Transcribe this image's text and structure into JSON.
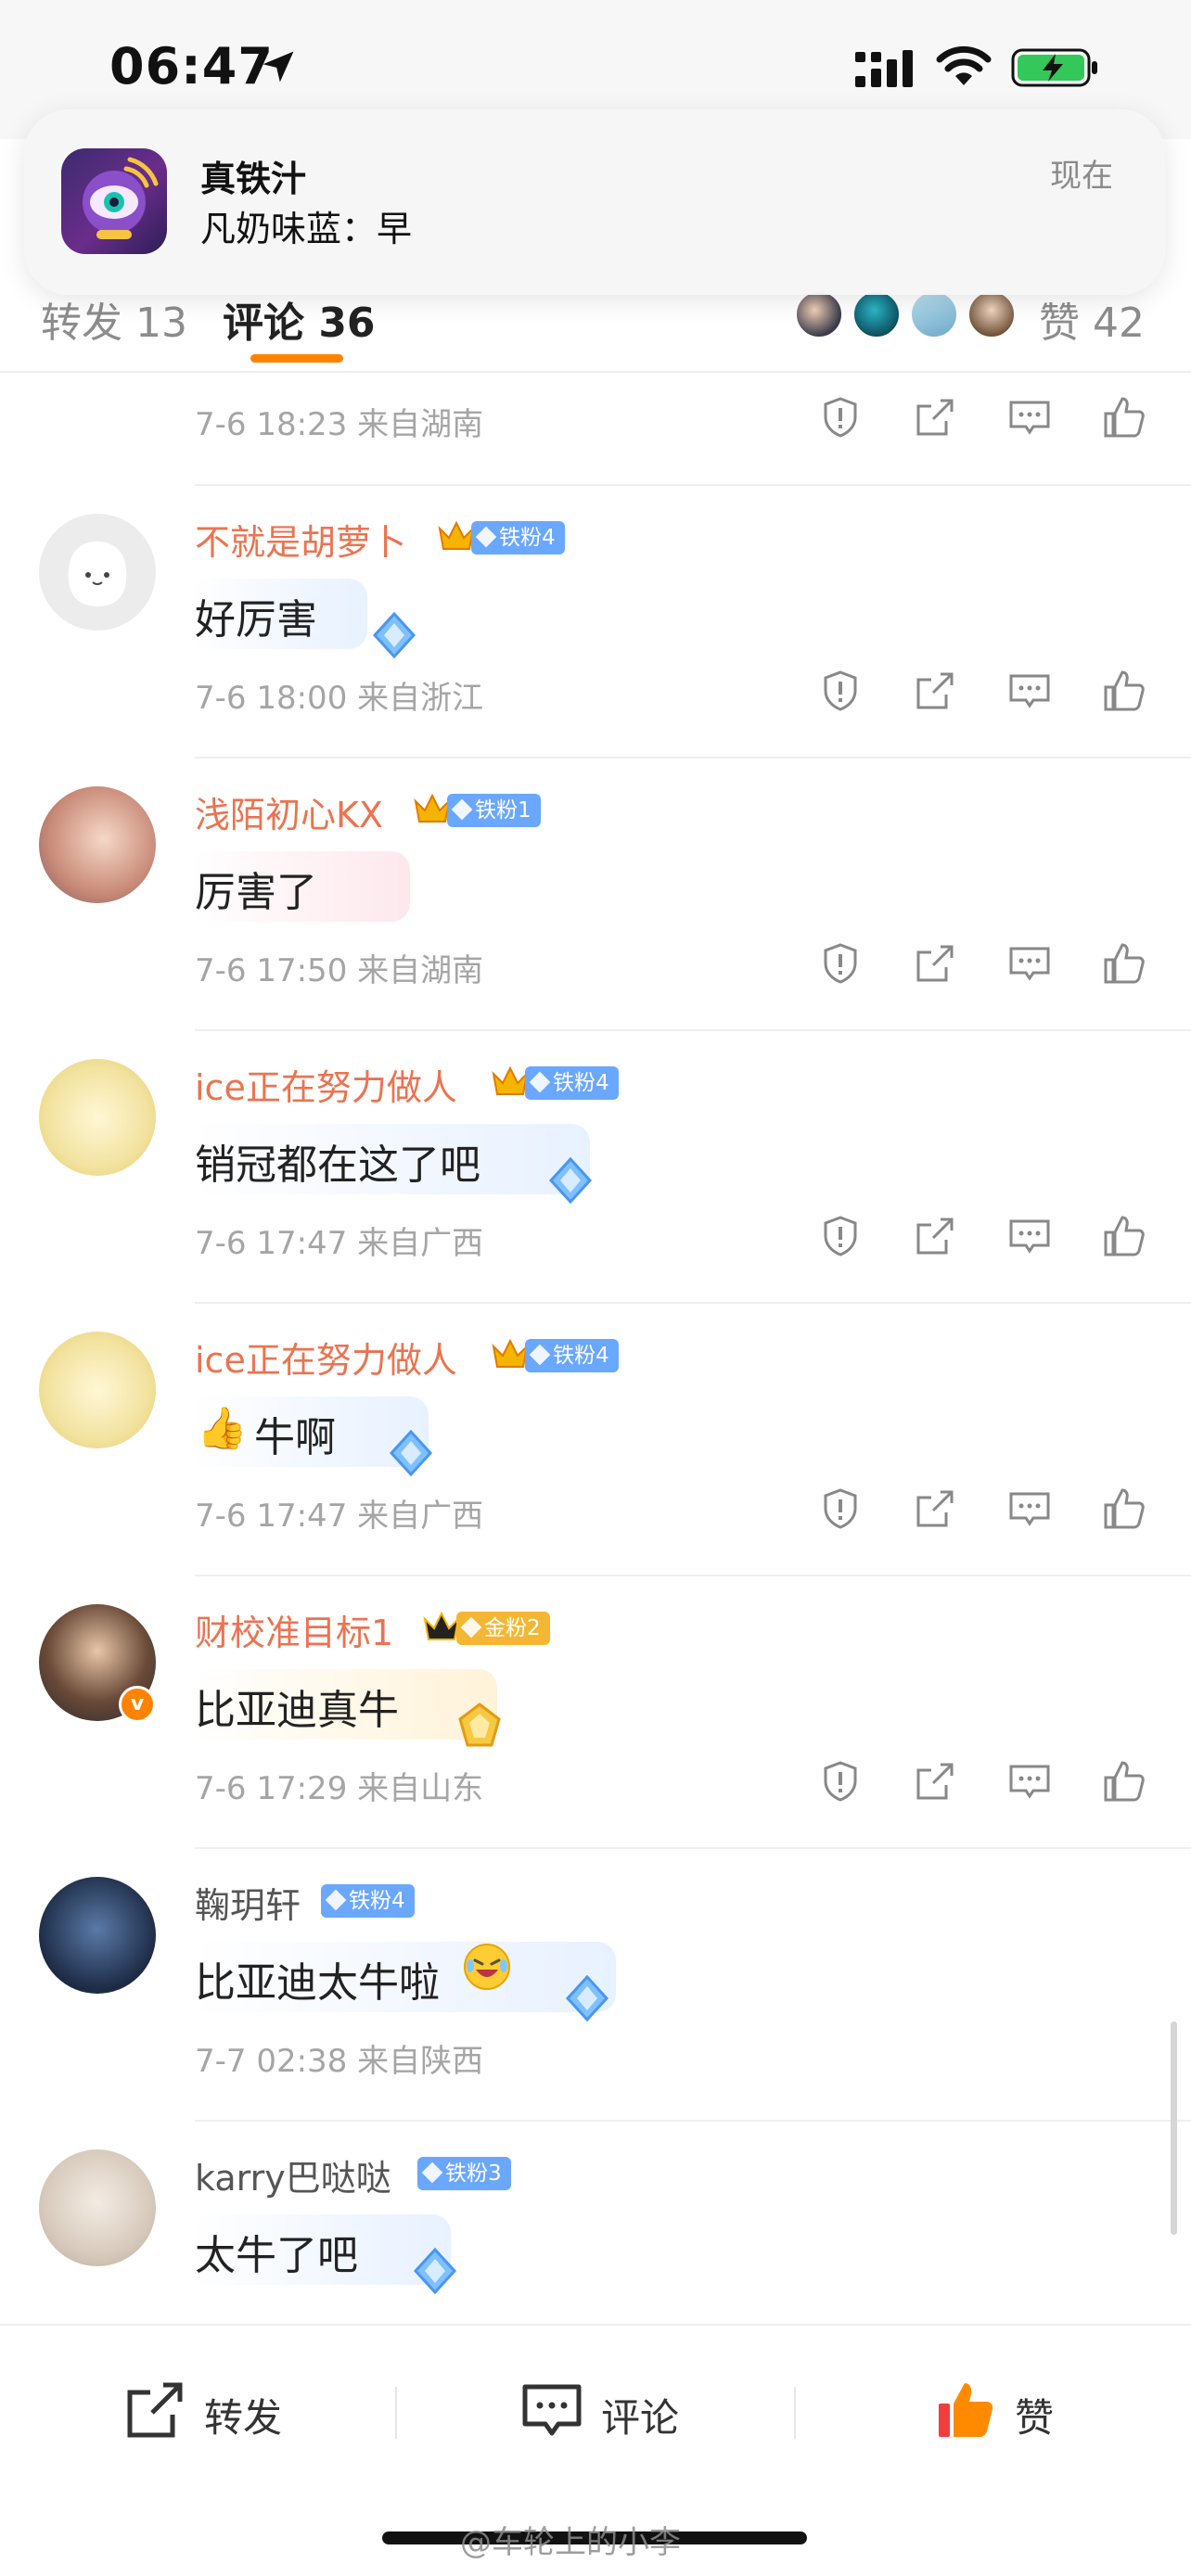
{
  "status_bar": {
    "time": "06:47"
  },
  "notification": {
    "title": "真铁汁",
    "body": "凡奶味蓝：早",
    "time": "现在"
  },
  "tabs": {
    "forward": "转发 13",
    "comment": "评论 36",
    "like": "赞 42"
  },
  "top_meta": {
    "text": "7-6 18:23  来自湖南"
  },
  "comments": [
    {
      "name": "不就是胡萝卜",
      "badge": "铁粉4",
      "text": "好厉害",
      "meta": "7-6 18:00  来自浙江"
    },
    {
      "name": "浅陌初心KX",
      "badge": "铁粉1",
      "text": "厉害了",
      "meta": "7-6 17:50  来自湖南"
    },
    {
      "name": "ice正在努力做人",
      "badge": "铁粉4",
      "text": "销冠都在这了吧",
      "meta": "7-6 17:47  来自广西"
    },
    {
      "name": "ice正在努力做人",
      "badge": "铁粉4",
      "text": "牛啊",
      "emoji": "👍",
      "meta": "7-6 17:47  来自广西"
    },
    {
      "name": "财校准目标1",
      "badge": "金粉2",
      "text": "比亚迪真牛",
      "meta": "7-6 17:29  来自山东",
      "verified": "v"
    },
    {
      "name": "鞠玥轩",
      "badge": "铁粉4",
      "text": "比亚迪太牛啦",
      "meta": "7-7 02:38  来自陕西"
    },
    {
      "name": "karry巴哒哒",
      "badge": "铁粉3",
      "text": "太牛了吧"
    }
  ],
  "bottom_bar": {
    "forward": "转发",
    "comment": "评论",
    "like": "赞"
  },
  "watermark": "@车轮上的小李",
  "colors": {
    "accent": "#ff8200",
    "name": "#eb7350",
    "badge_blue": "#6aa7ff",
    "badge_gold": "#f4b733"
  }
}
